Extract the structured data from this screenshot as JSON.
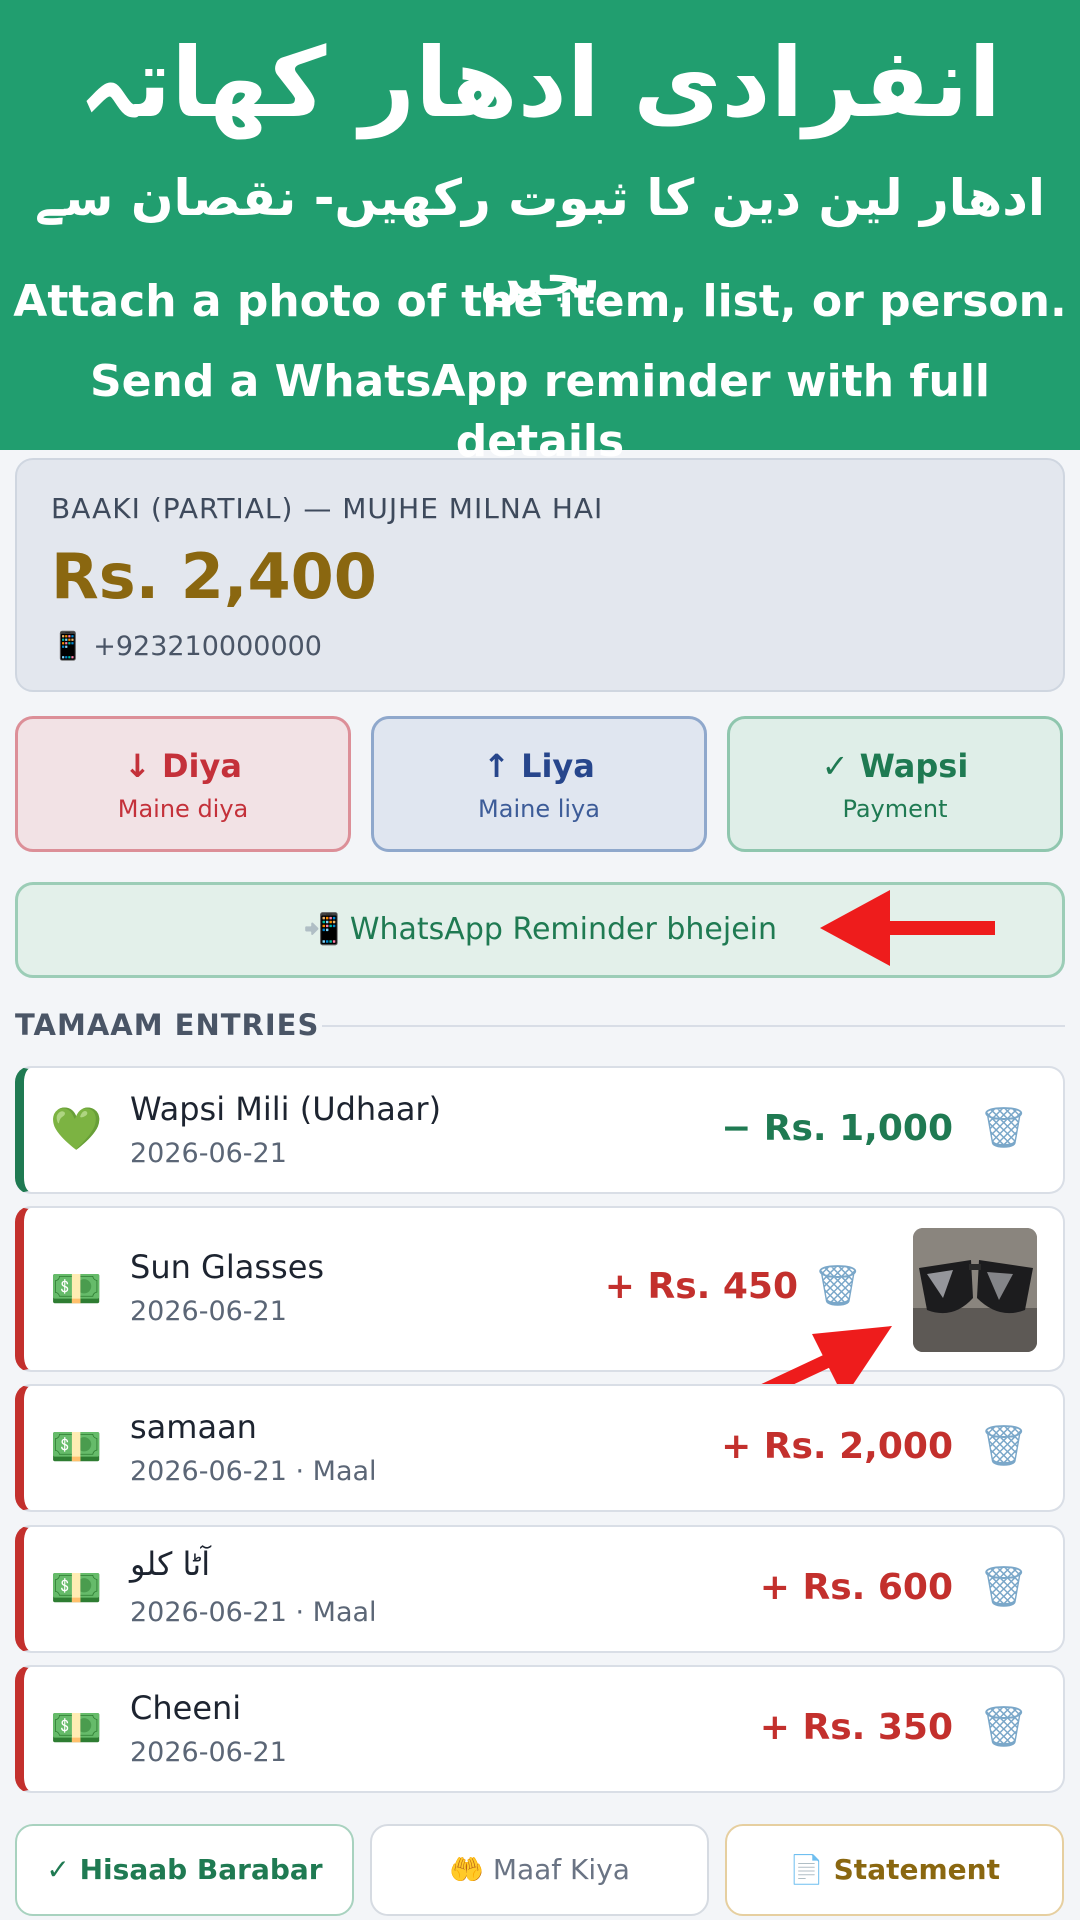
{
  "banner": {
    "urdu_title": "انفرادی ادھار کھاتہ",
    "urdu_subtitle": "ادھار لین دین کا ثبوت رکھیں- نقصان سے بچیں",
    "line1": "Attach a photo of the item, list, or person.",
    "line2": "Send a WhatsApp reminder with full details",
    "color": "#219e6f"
  },
  "summary": {
    "label": "BAAKI (PARTIAL) — MUJHE MILNA HAI",
    "amount": "Rs. 2,400",
    "phone_icon": "📱",
    "phone": "+923210000000"
  },
  "actions": {
    "diya": {
      "title": "↓ Diya",
      "subtitle": "Maine diya"
    },
    "liya": {
      "title": "↑ Liya",
      "subtitle": "Maine liya"
    },
    "wapsi": {
      "title": "✓ Wapsi",
      "subtitle": "Payment"
    }
  },
  "whatsapp_button": "📲 WhatsApp Reminder bhejein",
  "entries_heading": "TAMAAM ENTRIES",
  "entries": [
    {
      "icon": "💚",
      "name": "Wapsi Mili (Udhaar)",
      "date": "2026-06-21",
      "amount": "− Rs. 1,000",
      "type": "return"
    },
    {
      "icon": "💵",
      "name": "Sun Glasses",
      "date": "2026-06-21",
      "amount": "+ Rs. 450",
      "type": "given",
      "has_photo": true
    },
    {
      "icon": "💵",
      "name": "samaan",
      "date": "2026-06-21 · Maal",
      "amount": "+ Rs. 2,000",
      "type": "given"
    },
    {
      "icon": "💵",
      "name": "آٹا کلو",
      "date": "2026-06-21 · Maal",
      "amount": "+ Rs. 600",
      "type": "given"
    },
    {
      "icon": "💵",
      "name": "Cheeni",
      "date": "2026-06-21",
      "amount": "+ Rs. 350",
      "type": "given"
    }
  ],
  "trash_icon": "🗑",
  "bottom": {
    "settled": "✓ Hisaab Barabar",
    "forgiven": "🤲 Maaf Kiya",
    "statement": "📄 Statement"
  },
  "colors": {
    "given": "#c3302d",
    "return": "#1f7a52",
    "annotation_arrow": "#ee1c1c"
  }
}
